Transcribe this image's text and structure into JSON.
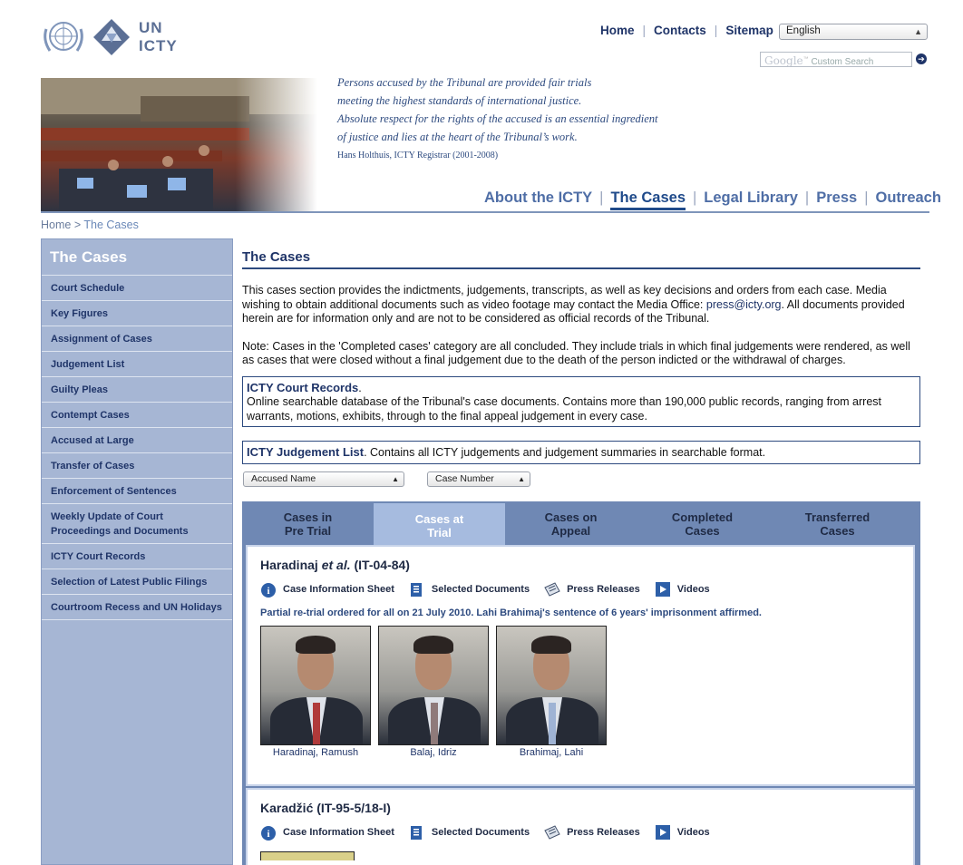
{
  "logo": {
    "line1": "UN",
    "line2": "ICTY"
  },
  "topnav": {
    "home": "Home",
    "contacts": "Contacts",
    "sitemap": "Sitemap",
    "language": "English"
  },
  "search": {
    "google": "Google",
    "placeholder": "Custom Search"
  },
  "quote": {
    "lines": [
      "Persons accused by the Tribunal are provided fair trials",
      "meeting the highest standards of international justice.",
      "Absolute respect for the rights of the accused is an essential ingredient",
      "of justice and lies at the heart of the Tribunal’s work."
    ],
    "author": "Hans Holthuis, ICTY Registrar (2001-2008)"
  },
  "mainnav": [
    "About the ICTY",
    "The Cases",
    "Legal Library",
    "Press",
    "Outreach"
  ],
  "breadcrumb": {
    "home": "Home",
    "sep": ">",
    "current": "The Cases"
  },
  "sidebar": {
    "title": "The Cases",
    "items": [
      "Court Schedule",
      "Key Figures",
      "Assignment of Cases",
      "Judgement List",
      "Guilty Pleas",
      "Contempt Cases",
      "Accused at Large",
      "Transfer of Cases",
      "Enforcement of Sentences",
      "Weekly Update of Court Proceedings and Documents",
      "ICTY Court Records",
      "Selection of Latest Public Filings",
      "Courtroom Recess and UN Holidays"
    ]
  },
  "content": {
    "title": "The Cases",
    "intro_pre": "This cases section provides the indictments, judgements, transcripts, as well as key decisions and orders from each case. Media wishing to obtain additional documents such as video footage may contact the Media Office: ",
    "intro_email": "press@icty.org",
    "intro_post": ". All documents provided herein are for information only and are not to be considered as official records of the Tribunal.",
    "note": "Note: Cases in the 'Completed cases' category are all concluded. They include trials in which final judgements were rendered, as well as cases that were closed without a final judgement due to the death of the person indicted or the withdrawal of charges.",
    "records_title": "ICTY Court Records",
    "records_dot": ".",
    "records_text": "Online searchable database of the Tribunal's case documents. Contains more than 190,000 public records, ranging from arrest warrants, motions, exhibits, through to the final appeal judgement in every case.",
    "judgement_title": "ICTY Judgement List",
    "judgement_text": ". Contains all ICTY judgements and judgement summaries in searchable format."
  },
  "filters": {
    "accused": "Accused Name",
    "case_number": "Case Number"
  },
  "tabs": [
    {
      "l1": "Cases in",
      "l2": "Pre Trial"
    },
    {
      "l1": "Cases at",
      "l2": "Trial"
    },
    {
      "l1": "Cases on",
      "l2": "Appeal"
    },
    {
      "l1": "Completed",
      "l2": "Cases"
    },
    {
      "l1": "Transferred",
      "l2": "Cases"
    }
  ],
  "link_labels": {
    "info": "Case Information Sheet",
    "docs": "Selected Documents",
    "press": "Press Releases",
    "videos": "Videos"
  },
  "cases": [
    {
      "name": "Haradinaj ",
      "etal": "et al.",
      "number": " (IT-04-84)",
      "note": "Partial re-trial ordered for all on 21 July 2010. Lahi Brahimaj's sentence of 6 years' imprisonment affirmed.",
      "accused": [
        "Haradinaj, Ramush",
        "Balaj, Idriz",
        "Brahimaj, Lahi"
      ]
    },
    {
      "name": "Karadžić (IT-95-5/18-I)"
    }
  ],
  "colors": {
    "accent": "#1f3468",
    "sidebar": "#a6b6d4",
    "tabbar": "#6f88b4",
    "note": "#2d4a7f"
  }
}
